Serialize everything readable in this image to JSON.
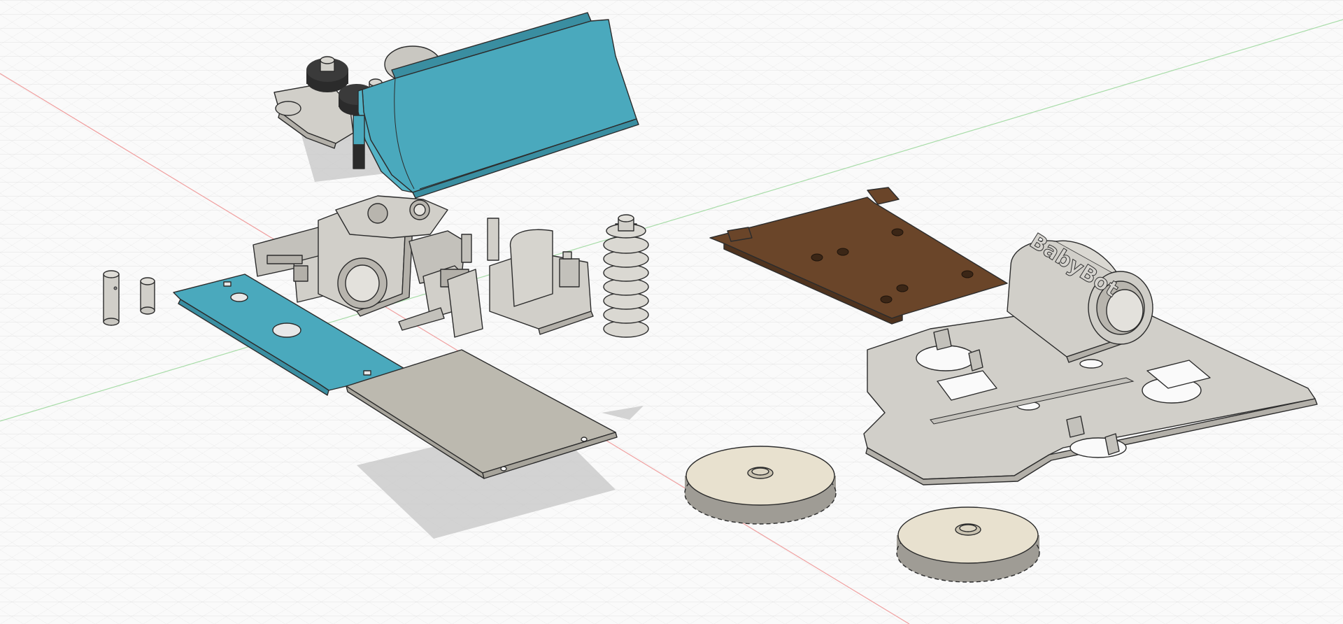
{
  "viewport": {
    "kind": "cad-3d-viewport",
    "grid": true,
    "axes": [
      "x-axis-red",
      "y-axis-green"
    ]
  },
  "colors": {
    "background": "#fafafa",
    "grid_line": "#d9d9d9",
    "x_axis": "#f0a0a0",
    "y_axis": "#a8dca8",
    "part_gray": "#d1cfc9",
    "part_gray_dark": "#b3b0a9",
    "part_blue": "#4aa9bd",
    "part_blue_dark": "#3a8ea1",
    "part_brown": "#6a4529",
    "part_black": "#2b2b2b",
    "shadow": "#c4c4c4"
  },
  "parts": [
    {
      "name": "bucket-arm-assembly",
      "color": "part_blue"
    },
    {
      "name": "gearbox-housing-parts",
      "color": "part_gray"
    },
    {
      "name": "worm-gear",
      "color": "part_gray"
    },
    {
      "name": "pins",
      "color": "part_gray"
    },
    {
      "name": "blue-plate",
      "color": "part_blue"
    },
    {
      "name": "gray-plate",
      "color": "part_gray"
    },
    {
      "name": "brown-top-plate",
      "color": "part_brown"
    },
    {
      "name": "chassis-base-plate",
      "color": "part_gray"
    },
    {
      "name": "spur-gear-1",
      "color": "part_gray"
    },
    {
      "name": "spur-gear-2",
      "color": "part_gray"
    }
  ],
  "engraved_text": "BabyBot"
}
